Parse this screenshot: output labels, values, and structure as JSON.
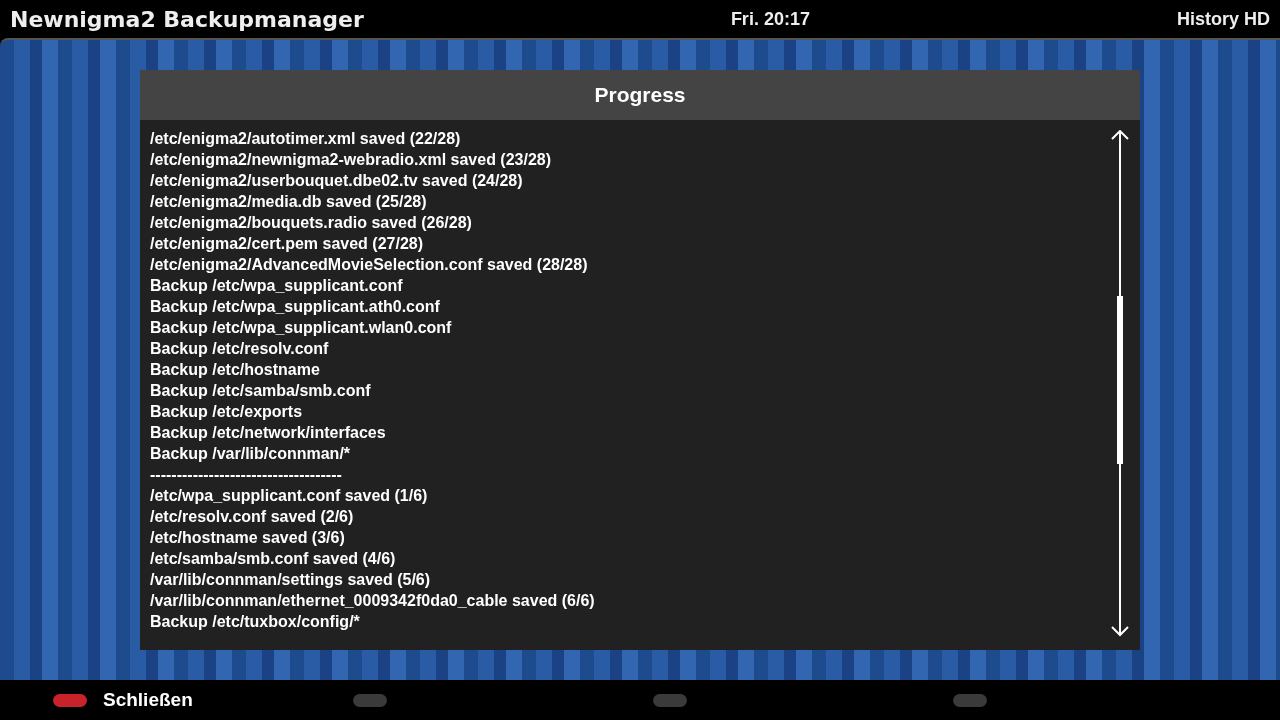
{
  "top_bar": {
    "title": "Newnigma2 Backupmanager",
    "clock": "Fri. 20:17",
    "channel": "History HD"
  },
  "dialog": {
    "title": "Progress",
    "lines": [
      "/etc/enigma2/autotimer.xml saved (22/28)",
      "/etc/enigma2/newnigma2-webradio.xml saved (23/28)",
      "/etc/enigma2/userbouquet.dbe02.tv saved (24/28)",
      "/etc/enigma2/media.db saved (25/28)",
      "/etc/enigma2/bouquets.radio saved (26/28)",
      "/etc/enigma2/cert.pem saved (27/28)",
      "/etc/enigma2/AdvancedMovieSelection.conf saved (28/28)",
      "Backup /etc/wpa_supplicant.conf",
      "Backup /etc/wpa_supplicant.ath0.conf",
      "Backup /etc/wpa_supplicant.wlan0.conf",
      "Backup /etc/resolv.conf",
      "Backup /etc/hostname",
      "Backup /etc/samba/smb.conf",
      "Backup /etc/exports",
      "Backup /etc/network/interfaces",
      "Backup /var/lib/connman/*",
      "------------------------------------",
      "/etc/wpa_supplicant.conf saved (1/6)",
      "/etc/resolv.conf saved (2/6)",
      "/etc/hostname saved (3/6)",
      "/etc/samba/smb.conf saved (4/6)",
      "/var/lib/connman/settings saved (5/6)",
      "/var/lib/connman/ethernet_0009342f0da0_cable saved (6/6)",
      "Backup /etc/tuxbox/config/*"
    ]
  },
  "color_buttons": [
    {
      "label": "Schließen",
      "color": "#c8232b"
    },
    {
      "color": "#3a3a3a"
    },
    {
      "color": "#3a3a3a"
    },
    {
      "color": "#3a3a3a"
    }
  ]
}
